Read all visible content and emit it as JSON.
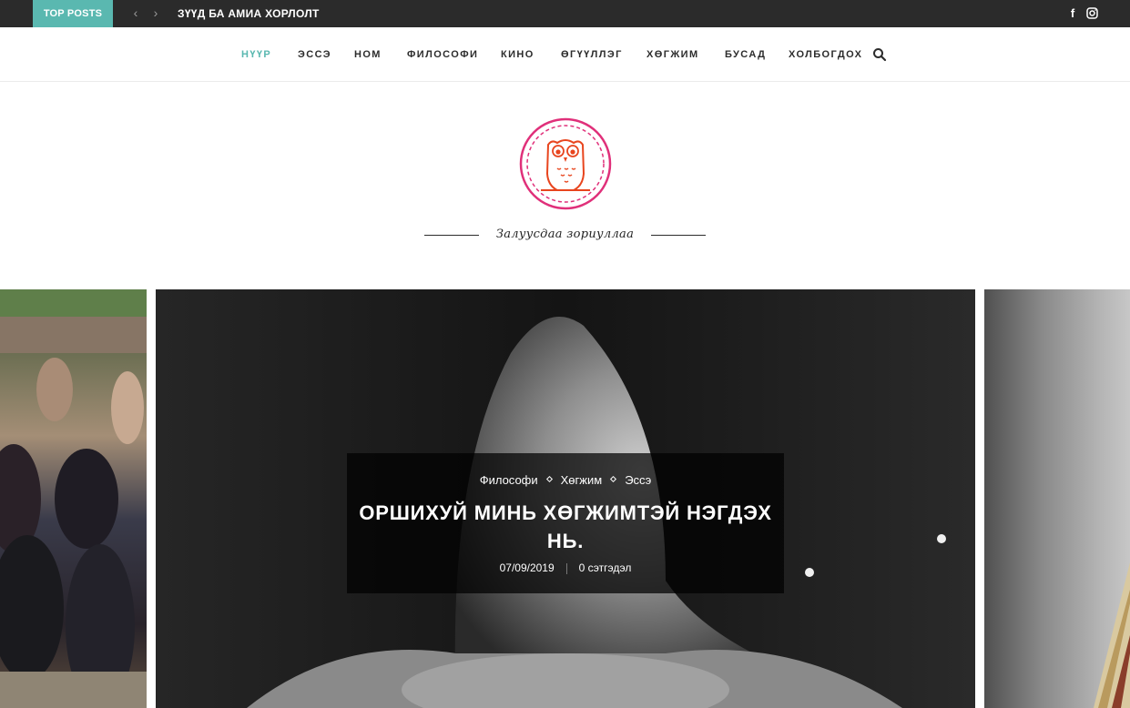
{
  "topbar": {
    "label": "TOP POSTS",
    "prev_icon": "‹",
    "next_icon": "›",
    "headline": "ЗҮҮД БА АМИА ХОРЛОЛТ",
    "social": {
      "facebook": "f",
      "instagram_icon": "instagram-icon"
    }
  },
  "nav": {
    "items": [
      {
        "label": "НҮҮР"
      },
      {
        "label": "ЭССЭ"
      },
      {
        "label": "НОМ"
      },
      {
        "label": "ФИЛОСОФИ"
      },
      {
        "label": "КИНО"
      },
      {
        "label": "ӨГҮҮЛЛЭГ"
      },
      {
        "label": "ХӨГЖИМ"
      },
      {
        "label": "БУСАД"
      },
      {
        "label": "ХОЛБОГДОХ"
      }
    ],
    "search_icon": "search-icon"
  },
  "branding": {
    "tagline": "Залуусдаа зориуллаа",
    "colors": {
      "logo_ring": "#e0307a",
      "logo_owl": "#e8451e",
      "accent": "#5ab8b0"
    }
  },
  "featured": {
    "categories": [
      "Философи",
      "Хөгжим",
      "Эссэ"
    ],
    "title": "ОРШИХУЙ МИНЬ ХӨГЖИМТЭЙ НЭГДЭХ НЬ.",
    "date": "07/09/2019",
    "comments": "0 сэтгэдэл"
  }
}
